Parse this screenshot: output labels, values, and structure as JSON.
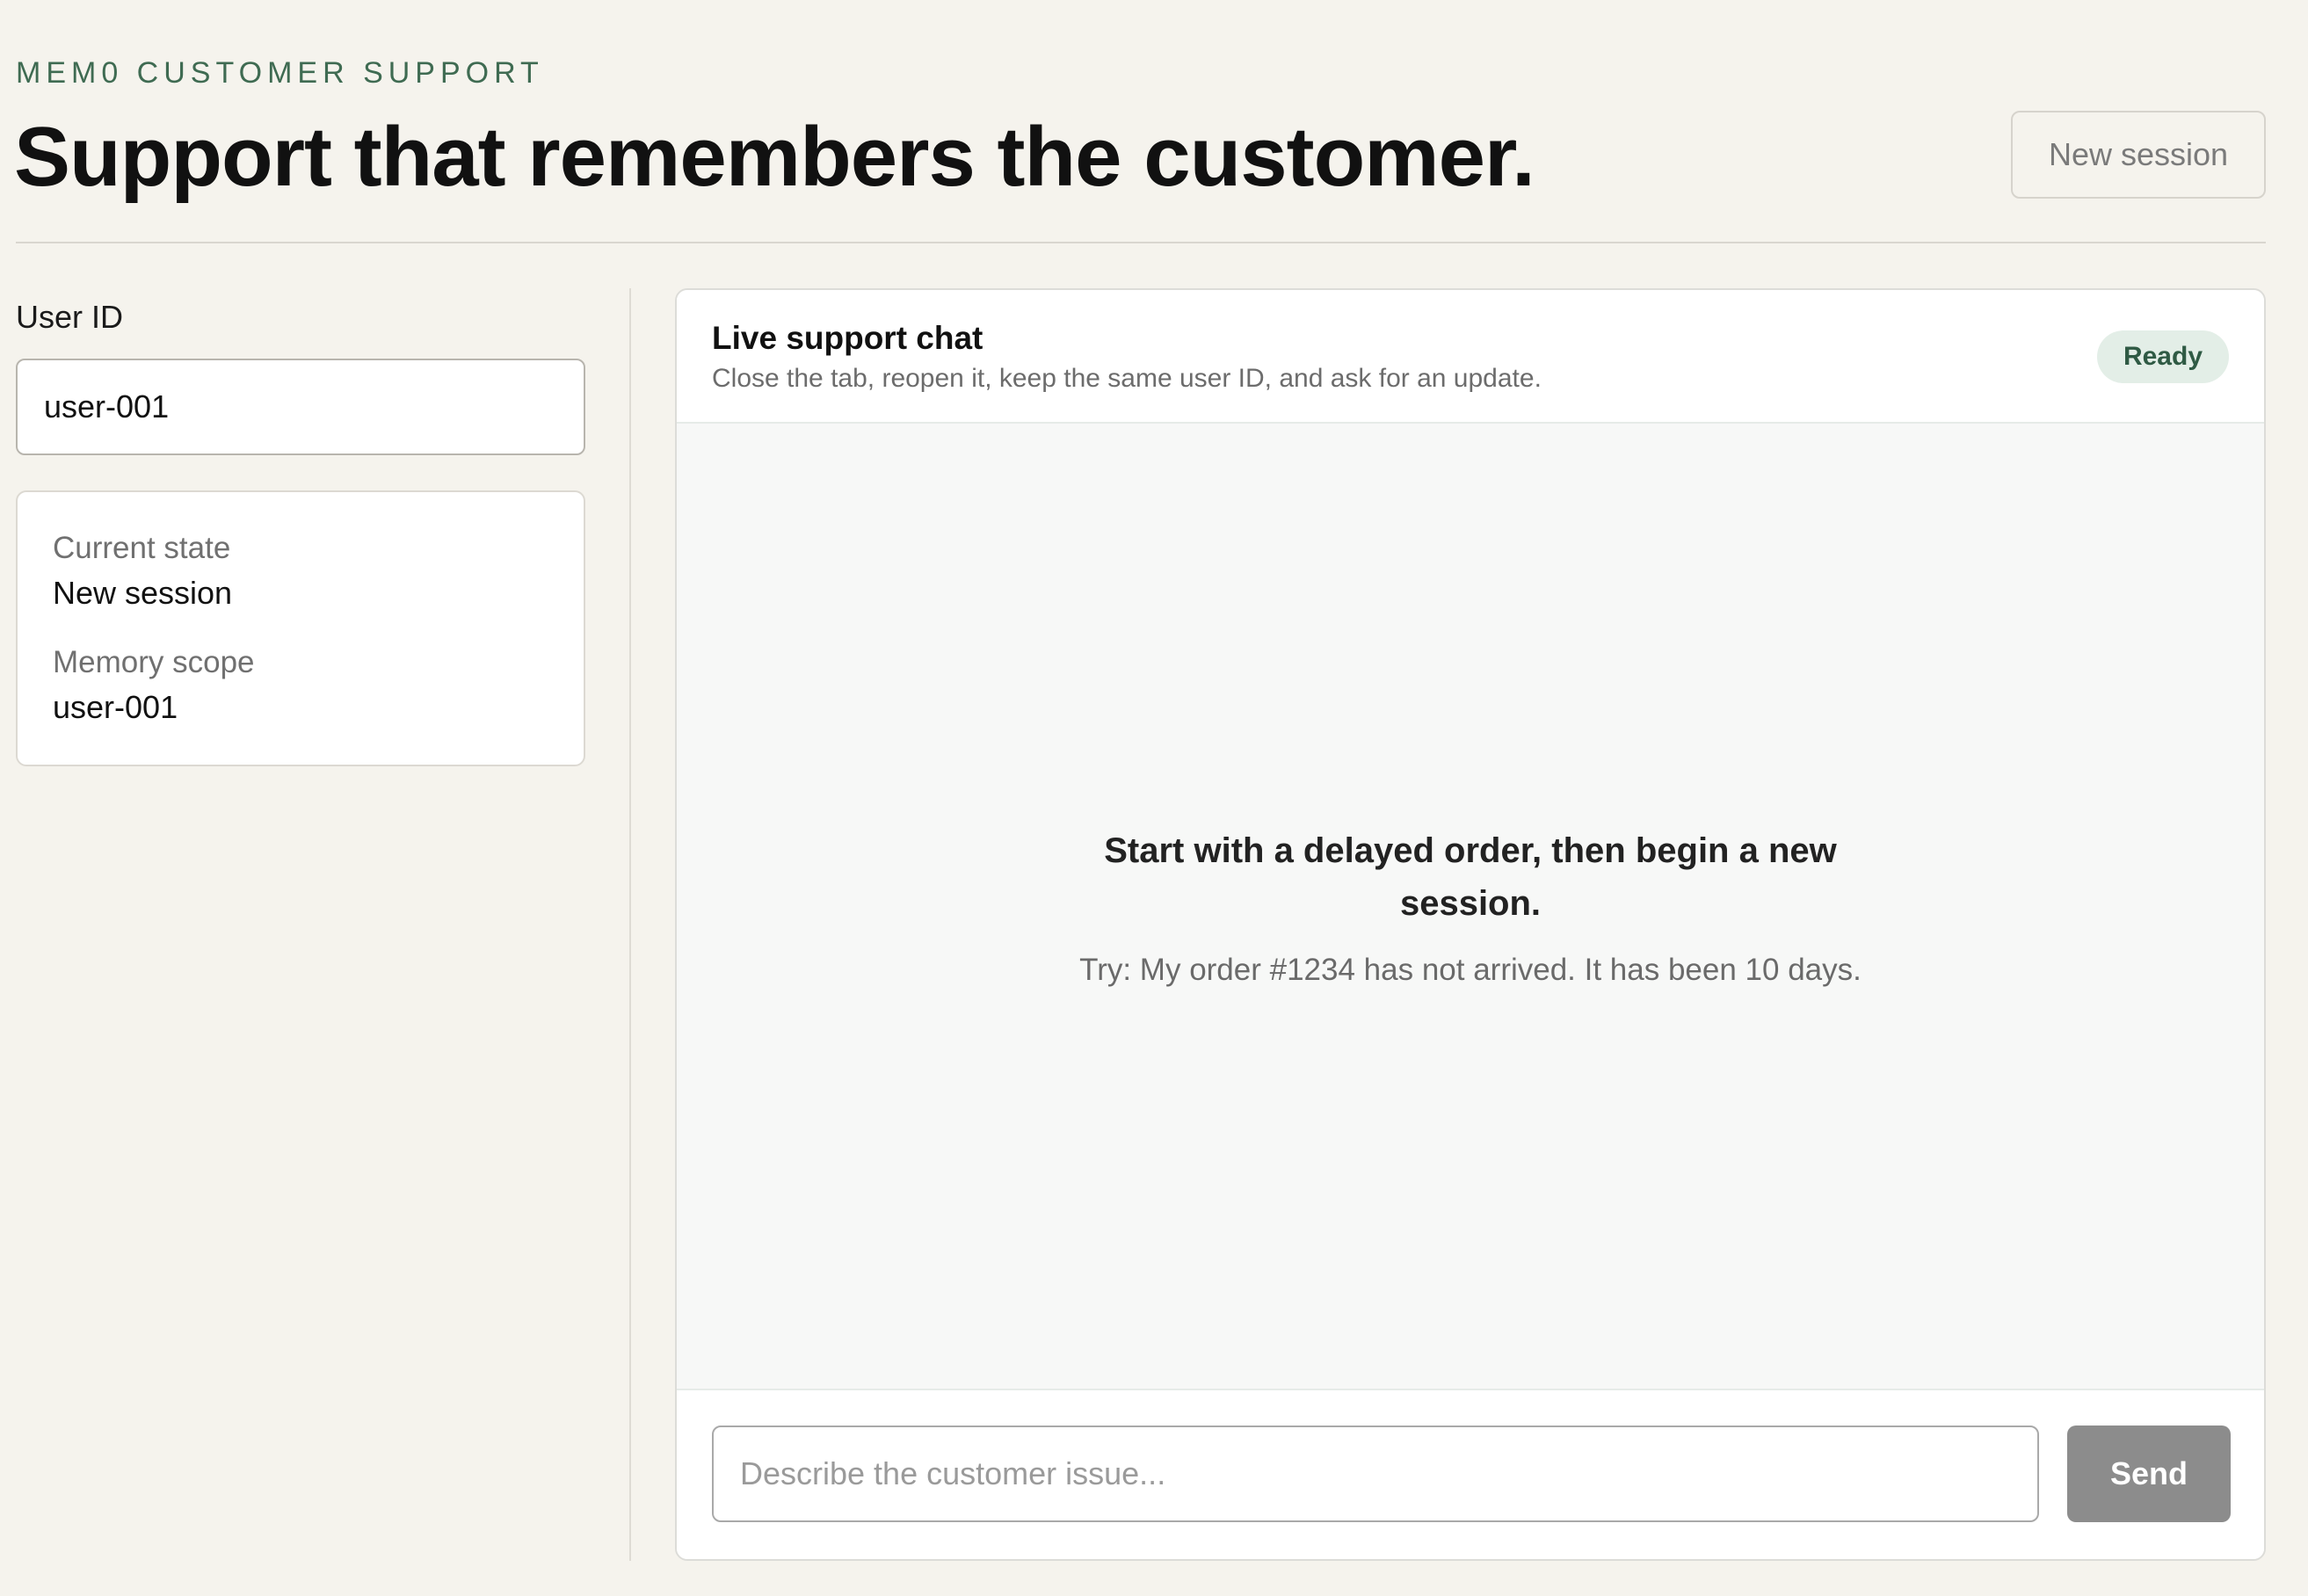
{
  "header": {
    "eyebrow": "MEM0 CUSTOMER SUPPORT",
    "title": "Support that remembers the customer.",
    "new_session_label": "New session"
  },
  "sidebar": {
    "user_id_label": "User ID",
    "user_id_value": "user-001",
    "state_card": {
      "current_state_label": "Current state",
      "current_state_value": "New session",
      "memory_scope_label": "Memory scope",
      "memory_scope_value": "user-001"
    }
  },
  "chat": {
    "title": "Live support chat",
    "subtitle": "Close the tab, reopen it, keep the same user ID, and ask for an update.",
    "status": "Ready",
    "empty_title": "Start with a delayed order, then begin a new session.",
    "empty_hint": "Try: My order #1234 has not arrived. It has been 10 days.",
    "input_placeholder": "Describe the customer issue...",
    "send_label": "Send"
  },
  "colors": {
    "page_background": "#f5f3ed",
    "accent_green": "#3f6b52",
    "badge_background": "#e3eee7",
    "send_button": "#8c8c8c"
  }
}
